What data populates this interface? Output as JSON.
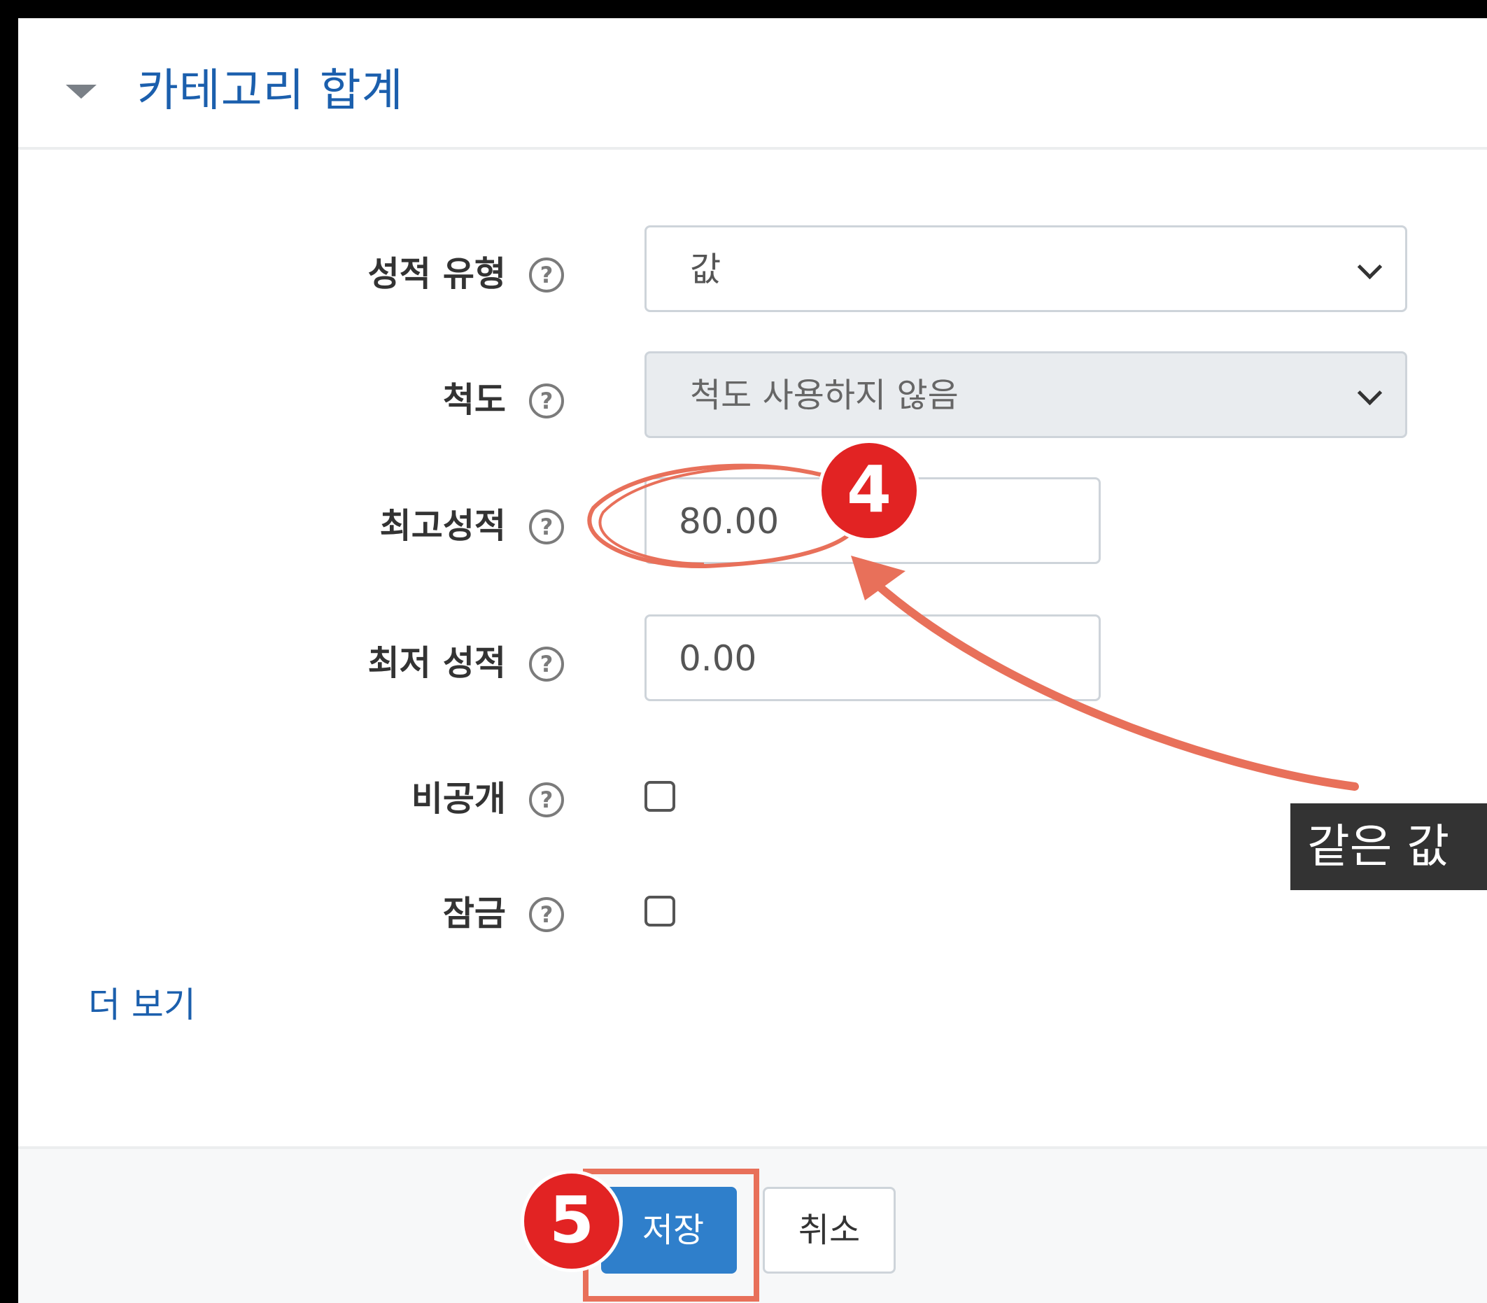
{
  "section": {
    "title": "카테고리 합계"
  },
  "form": {
    "grade_type": {
      "label": "성적 유형",
      "value": "값"
    },
    "scale": {
      "label": "척도",
      "value": "척도 사용하지 않음"
    },
    "max_grade": {
      "label": "최고성적",
      "value": "80.00"
    },
    "min_grade": {
      "label": "최저 성적",
      "value": "0.00"
    },
    "hidden": {
      "label": "비공개",
      "checked": false
    },
    "locked": {
      "label": "잠금",
      "checked": false
    },
    "help_glyph": "?",
    "more_link": "더 보기"
  },
  "footer": {
    "save_label": "저장",
    "cancel_label": "취소"
  },
  "annotations": {
    "step4": "4",
    "step5": "5",
    "note": "같은 값",
    "accent_color": "#e8705a",
    "badge_color": "#e22323"
  }
}
